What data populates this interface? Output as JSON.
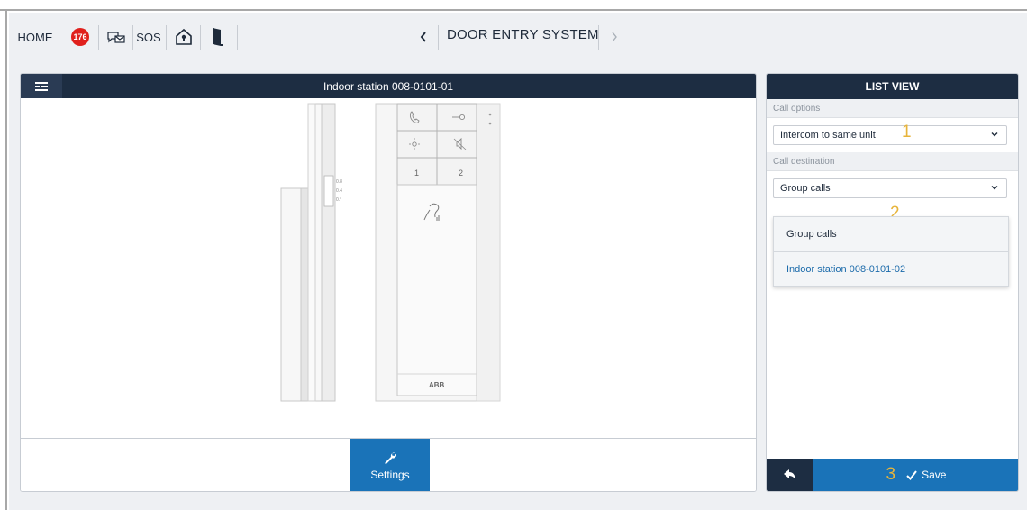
{
  "topbar": {
    "home_label": "HOME",
    "notifications_count": "176",
    "sos_label": "SOS",
    "title": "DOOR ENTRY SYSTEM"
  },
  "main": {
    "header_title": "Indoor station 008-0101-01",
    "device": {
      "button_1": "1",
      "button_2": "2",
      "brand": "ABB",
      "side_labels": [
        "0.8",
        "0.4",
        "0.*"
      ]
    },
    "settings_label": "Settings"
  },
  "list_view": {
    "title": "LIST VIEW",
    "call_options_label": "Call options",
    "call_options_value": "Intercom to same unit",
    "call_destination_label": "Call destination",
    "call_destination_value": "Group calls",
    "dropdown_options": [
      "Group calls",
      "Indoor station 008-0101-02"
    ],
    "save_label": "Save"
  },
  "annotations": [
    "1",
    "2",
    "3"
  ],
  "colors": {
    "header_dark": "#1d2d42",
    "accent_blue": "#1a73b8",
    "badge_red": "#e0201c",
    "annotation_gold": "#e7b43b"
  }
}
